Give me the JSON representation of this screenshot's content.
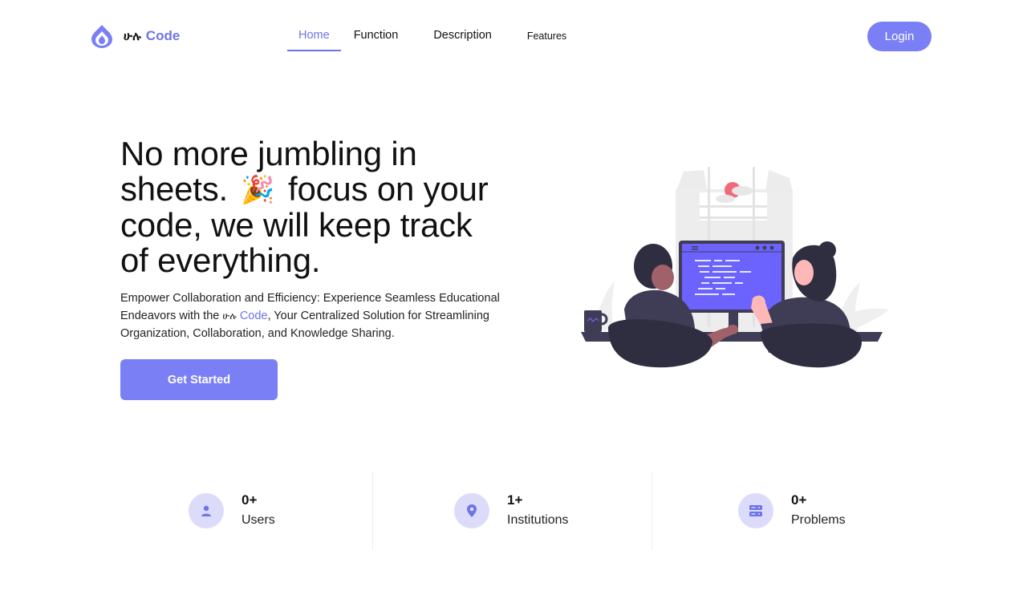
{
  "brand": {
    "script": "ሁሉ",
    "name": "Code"
  },
  "nav": {
    "links": [
      "Home",
      "Function",
      "Description",
      "Features"
    ],
    "active": "Home",
    "login_label": "Login"
  },
  "hero": {
    "title_line1": "No more jumbling in",
    "title_line2a": "sheets.",
    "title_emoji": "🎉",
    "title_line2b": "focus on your",
    "title_line3": "code, we will keep track",
    "title_line4": "of everything.",
    "desc_part1": "Empower Collaboration and Efficiency: Experience Seamless Educational Endeavors with the ",
    "desc_script": "ሁሉ",
    "desc_code": "Code",
    "desc_part2": ", Your Centralized Solution for Streamlining Organization, Collaboration, and Knowledge Sharing.",
    "cta_label": "Get Started"
  },
  "stats": [
    {
      "value": "0+",
      "label": "Users",
      "icon": "user-icon"
    },
    {
      "value": "1+",
      "label": "Institutions",
      "icon": "location-pin-icon"
    },
    {
      "value": "0+",
      "label": "Problems",
      "icon": "server-icon"
    }
  ],
  "colors": {
    "accent": "#6f74e9",
    "button": "#7b7ff5",
    "icon_circle": "#dcdcfa",
    "illustration_dark": "#3f3d56",
    "illustration_screen": "#6c63ff"
  }
}
